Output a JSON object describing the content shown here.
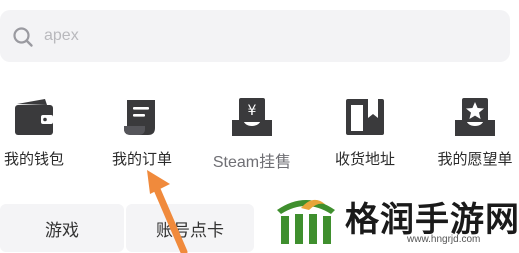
{
  "search": {
    "placeholder": "apex"
  },
  "entries": [
    {
      "label": "我的钱包",
      "icon": "wallet-icon"
    },
    {
      "label": "我的订单",
      "icon": "order-document-icon"
    },
    {
      "label": "Steam挂售",
      "icon": "yen-tray-icon"
    },
    {
      "label": "收货地址",
      "icon": "address-box-icon"
    },
    {
      "label": "我的愿望单",
      "icon": "star-tray-icon"
    }
  ],
  "tabs": [
    {
      "label": "游戏"
    },
    {
      "label": "账号点卡"
    }
  ],
  "watermark": {
    "title": "格润手游网",
    "url": "www.hngrjd.com"
  },
  "colors": {
    "icon": "#3a3a3c",
    "arrow": "#f08a3c",
    "search_bg": "#f3f3f5",
    "logo_green": "#3f8f2e"
  }
}
